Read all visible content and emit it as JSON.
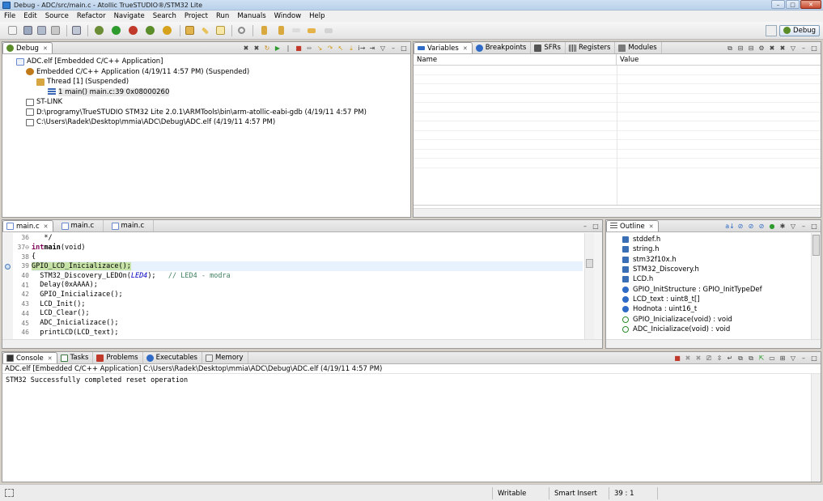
{
  "window": {
    "title": "Debug - ADC/src/main.c - Atollic TrueSTUDIO®/STM32 Lite",
    "buttons": [
      "–",
      "□",
      "✕"
    ]
  },
  "menu": [
    "File",
    "Edit",
    "Source",
    "Refactor",
    "Navigate",
    "Search",
    "Project",
    "Run",
    "Manuals",
    "Window",
    "Help"
  ],
  "perspective": {
    "label": "Debug"
  },
  "debug_view": {
    "tab": "Debug",
    "tree": [
      {
        "label": "ADC.elf [Embedded C/C++ Application]",
        "indent": 0,
        "icon_color": "#6a8ad0"
      },
      {
        "label": "Embedded C/C++ Application (4/19/11 4:57 PM) (Suspended)",
        "indent": 1,
        "icon_color": "#c07a1a"
      },
      {
        "label": "Thread [1] (Suspended)",
        "indent": 2,
        "icon_color": "#d7a640"
      },
      {
        "label": "1 main() main.c:39 0x08000260",
        "indent": 3,
        "icon_color": "#3a69b8"
      },
      {
        "label": "ST-LINK",
        "indent": 1,
        "icon_color": "#6a6a6a"
      },
      {
        "label": "D:\\programy\\TrueSTUDIO STM32 Lite 2.0.1\\ARMTools\\bin\\arm-atollic-eabi-gdb (4/19/11 4:57 PM)",
        "indent": 1,
        "icon_color": "#6a6a6a"
      },
      {
        "label": "C:\\Users\\Radek\\Desktop\\mmia\\ADC\\Debug\\ADC.elf (4/19/11 4:57 PM)",
        "indent": 1,
        "icon_color": "#6a6a6a"
      }
    ]
  },
  "variables_view": {
    "tabs": [
      "Variables",
      "Breakpoints",
      "SFRs",
      "Registers",
      "Modules"
    ],
    "columns": [
      "Name",
      "Value"
    ]
  },
  "editor": {
    "tabs": [
      "main.c",
      "main.c",
      "main.c"
    ],
    "lines": [
      {
        "n": "36",
        "text": "   */"
      },
      {
        "n": "37⊖",
        "text": "int main(void)"
      },
      {
        "n": "38",
        "text": "{"
      },
      {
        "n": "39",
        "text": "  GPIO_LCD_Inicializace();"
      },
      {
        "n": "40",
        "text": "  STM32_Discovery_LEDOn(LED4);   // LED4 - modra"
      },
      {
        "n": "41",
        "text": "  Delay(0xAAAA);"
      },
      {
        "n": "42",
        "text": "  GPIO_Inicializace();"
      },
      {
        "n": "43",
        "text": "  LCD_Init();"
      },
      {
        "n": "44",
        "text": "  LCD_Clear();"
      },
      {
        "n": "45",
        "text": "  ADC_Inicializace();"
      },
      {
        "n": "46",
        "text": "  printLCD(LCD_text);"
      }
    ],
    "code": {
      "l36": "   */",
      "l37_kw": "int",
      "l37_fn": "main",
      "l37_rest": "(void)",
      "l38": "{",
      "l39": "GPIO_LCD_Inicializace();",
      "l40_a": "  STM32_Discovery_LEDOn(",
      "l40_macro": "LED4",
      "l40_b": ");   ",
      "l40_comment": "// LED4 - modra",
      "l41": "  Delay(0xAAAA);",
      "l42": "  GPIO_Inicializace();",
      "l43": "  LCD_Init();",
      "l44": "  LCD_Clear();",
      "l45": "  ADC_Inicializace();",
      "l46": "  printLCD(LCD_text);"
    }
  },
  "outline_view": {
    "tab": "Outline",
    "items": [
      {
        "label": "stddef.h",
        "kind": "file"
      },
      {
        "label": "string.h",
        "kind": "file"
      },
      {
        "label": "stm32f10x.h",
        "kind": "file"
      },
      {
        "label": "STM32_Discovery.h",
        "kind": "file"
      },
      {
        "label": "LCD.h",
        "kind": "file"
      },
      {
        "label": "GPIO_InitStructure : GPIO_InitTypeDef",
        "kind": "var"
      },
      {
        "label": "LCD_text : uint8_t[]",
        "kind": "var"
      },
      {
        "label": "Hodnota : uint16_t",
        "kind": "var"
      },
      {
        "label": "GPIO_Inicializace(void) : void",
        "kind": "fn"
      },
      {
        "label": "ADC_Inicializace(void) : void",
        "kind": "fn"
      }
    ]
  },
  "console_view": {
    "tabs": [
      "Console",
      "Tasks",
      "Problems",
      "Executables",
      "Memory"
    ],
    "header": "ADC.elf [Embedded C/C++ Application] C:\\Users\\Radek\\Desktop\\mmia\\ADC\\Debug\\ADC.elf (4/19/11 4:57 PM)",
    "output": "STM32 Successfully completed reset operation"
  },
  "status_bar": {
    "writable": "Writable",
    "insert_mode": "Smart Insert",
    "position": "39 : 1"
  }
}
